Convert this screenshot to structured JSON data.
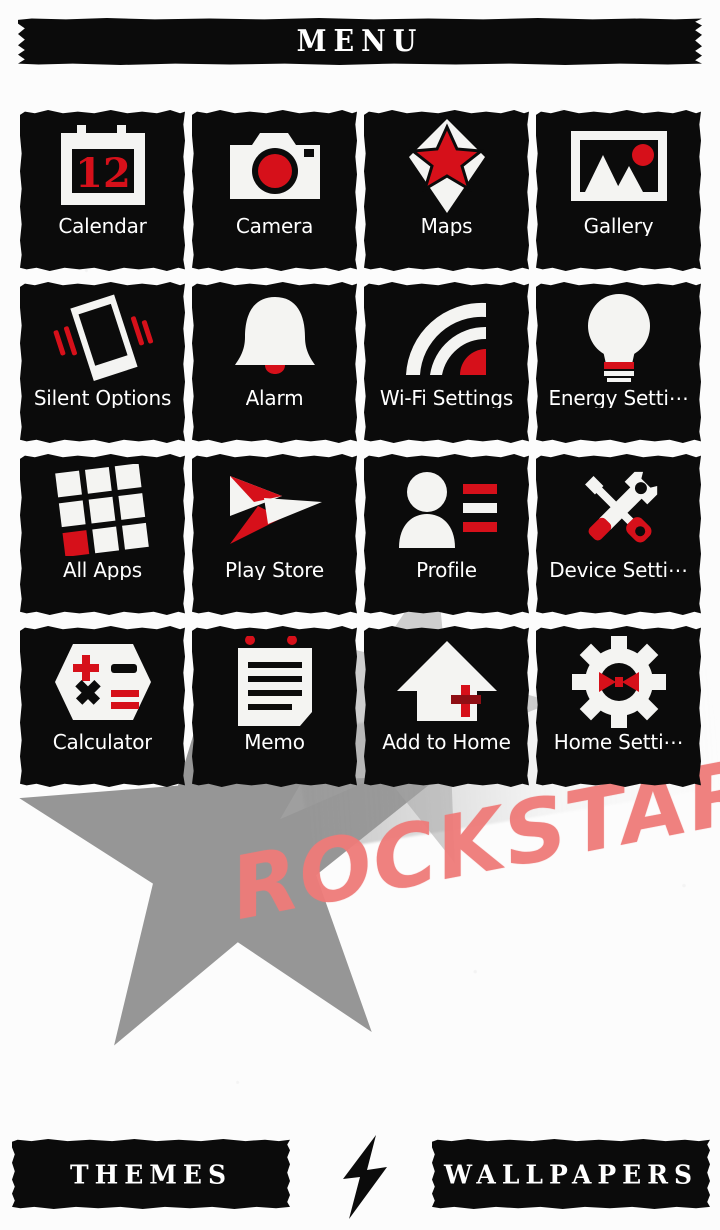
{
  "header": {
    "title": "MENU"
  },
  "theme": {
    "background": "#fcfcfc",
    "tile_bg": "#0b0b0b",
    "accent_red": "#d6101a",
    "label_color": "#ffffff",
    "watermark_color": "#ef7b79",
    "star_color": "#8d8d8d"
  },
  "watermark": {
    "text": "ROCKSTAR"
  },
  "grid": {
    "columns": 4,
    "rows": 4,
    "items": [
      {
        "label": "Calendar",
        "icon": "calendar-icon",
        "badge": "12"
      },
      {
        "label": "Camera",
        "icon": "camera-icon"
      },
      {
        "label": "Maps",
        "icon": "map-pin-star-icon"
      },
      {
        "label": "Gallery",
        "icon": "gallery-photo-icon"
      },
      {
        "label": "Silent Options",
        "icon": "vibrate-phone-icon"
      },
      {
        "label": "Alarm",
        "icon": "bell-icon"
      },
      {
        "label": "Wi-Fi Settings",
        "icon": "wifi-icon"
      },
      {
        "label": "Energy Setti⋯",
        "icon": "lightbulb-icon"
      },
      {
        "label": "All Apps",
        "icon": "app-grid-icon"
      },
      {
        "label": "Play Store",
        "icon": "play-store-icon"
      },
      {
        "label": "Profile",
        "icon": "profile-person-icon"
      },
      {
        "label": "Device Setti⋯",
        "icon": "wrench-screwdriver-icon"
      },
      {
        "label": "Calculator",
        "icon": "calculator-icon"
      },
      {
        "label": "Memo",
        "icon": "notepad-icon"
      },
      {
        "label": "Add to Home",
        "icon": "house-plus-icon"
      },
      {
        "label": "Home Setti⋯",
        "icon": "gear-icon"
      }
    ]
  },
  "footer": {
    "themes_label": "THEMES",
    "wallpapers_label": "WALLPAPERS",
    "divider_icon": "lightning-bolt-icon"
  }
}
